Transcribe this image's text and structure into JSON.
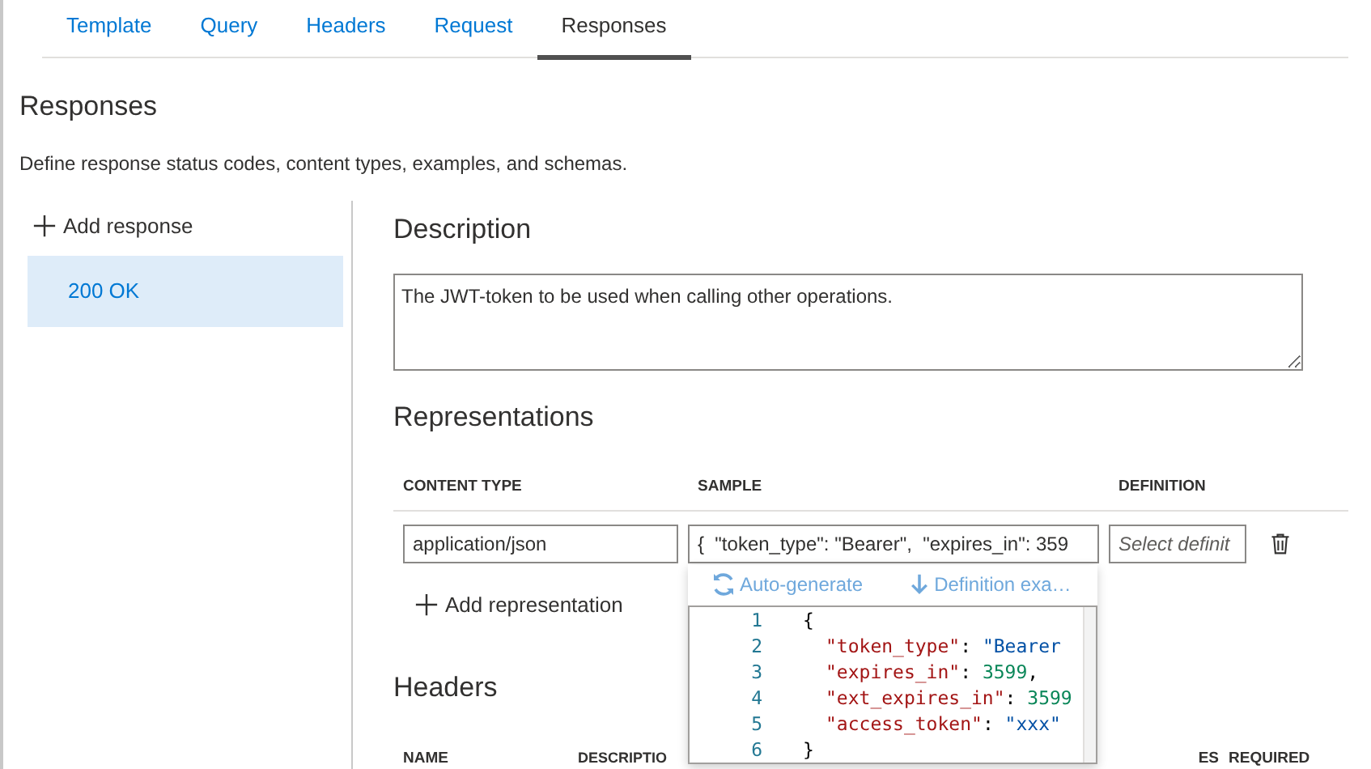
{
  "tabs": [
    {
      "label": "Template",
      "selected": false
    },
    {
      "label": "Query",
      "selected": false
    },
    {
      "label": "Headers",
      "selected": false
    },
    {
      "label": "Request",
      "selected": false
    },
    {
      "label": "Responses",
      "selected": true
    }
  ],
  "section": {
    "title": "Responses",
    "description": "Define response status codes, content types, examples, and schemas."
  },
  "responses": {
    "add_label": "Add response",
    "items": [
      {
        "label": "200 OK",
        "selected": true
      }
    ]
  },
  "description": {
    "title": "Description",
    "value": "The JWT-token to be used when calling other operations."
  },
  "representations": {
    "title": "Representations",
    "columns": [
      "CONTENT TYPE",
      "SAMPLE",
      "DEFINITION"
    ],
    "rows": [
      {
        "content_type": "application/json",
        "sample": "{  \"token_type\": \"Bearer\",  \"expires_in\": 359",
        "definition_placeholder": "Select definit"
      }
    ],
    "add_label": "Add representation"
  },
  "sample_popup": {
    "toolbar": [
      {
        "label": "Auto-generate",
        "kind": "regenerate",
        "disabled": true
      },
      {
        "label": "Definition exa…",
        "kind": "download",
        "disabled": true
      }
    ],
    "code_lines": [
      {
        "number": "1",
        "tokens": [
          {
            "text": "{",
            "kind": "punct"
          }
        ]
      },
      {
        "number": "2",
        "tokens": [
          {
            "text": "\"token_type\"",
            "kind": "key"
          },
          {
            "text": ": ",
            "kind": "punct"
          },
          {
            "text": "\"Bearer",
            "kind": "string"
          }
        ]
      },
      {
        "number": "3",
        "tokens": [
          {
            "text": "\"expires_in\"",
            "kind": "key"
          },
          {
            "text": ": ",
            "kind": "punct"
          },
          {
            "text": "3599",
            "kind": "number"
          },
          {
            "text": ",",
            "kind": "punct"
          }
        ]
      },
      {
        "number": "4",
        "tokens": [
          {
            "text": "\"ext_expires_in\"",
            "kind": "key"
          },
          {
            "text": ": ",
            "kind": "punct"
          },
          {
            "text": "3599",
            "kind": "number"
          }
        ]
      },
      {
        "number": "5",
        "tokens": [
          {
            "text": "\"access_token\"",
            "kind": "key"
          },
          {
            "text": ": ",
            "kind": "punct"
          },
          {
            "text": "\"xxx\"",
            "kind": "string"
          }
        ]
      },
      {
        "number": "6",
        "tokens": [
          {
            "text": "}",
            "kind": "punct"
          }
        ]
      }
    ]
  },
  "headers": {
    "title": "Headers",
    "columns": [
      "NAME",
      "DESCRIPTIO",
      "ES",
      "REQUIRED"
    ]
  }
}
